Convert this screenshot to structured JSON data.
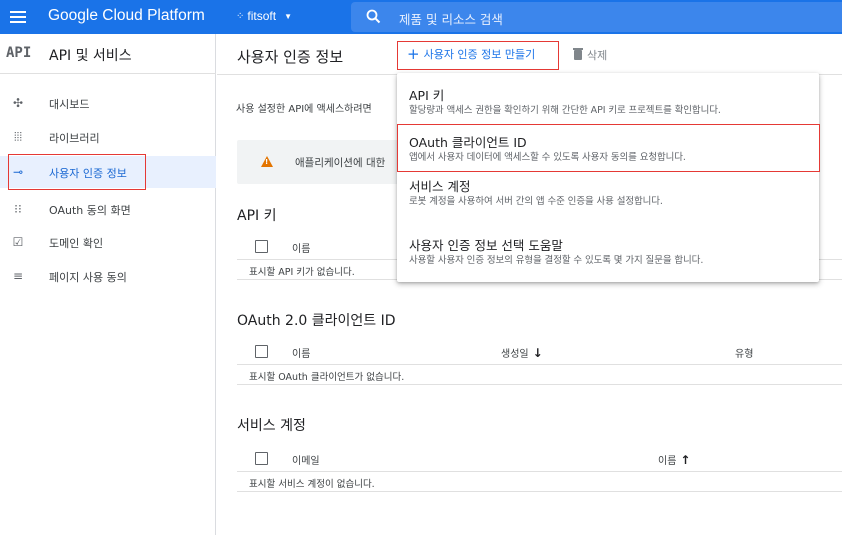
{
  "topbar": {
    "brand": "Google Cloud Platform",
    "project": "fitsoft",
    "search_placeholder": "제품 및 리소스 검색",
    "bg_color": "#1a73e8"
  },
  "sidebar": {
    "logo": "API",
    "title": "API 및 서비스",
    "items": [
      {
        "label": "대시보드",
        "icon": "dashboard-icon"
      },
      {
        "label": "라이브러리",
        "icon": "library-icon"
      },
      {
        "label": "사용자 인증 정보",
        "icon": "key-icon",
        "active": true
      },
      {
        "label": "OAuth 동의 화면",
        "icon": "consent-icon"
      },
      {
        "label": "도메인 확인",
        "icon": "domain-check-icon"
      },
      {
        "label": "페이지 사용 동의",
        "icon": "page-settings-icon"
      }
    ]
  },
  "main": {
    "title": "사용자 인증 정보",
    "create_label": "사용자 인증 정보 만들기",
    "delete_label": "삭제",
    "description": "사용 설정한 API에 액세스하려면",
    "warning": "애플리케이션에 대한",
    "sections": {
      "api_keys": {
        "title": "API 키",
        "col_name": "이름",
        "empty": "표시할 API 키가 없습니다."
      },
      "oauth": {
        "title": "OAuth 2.0 클라이언트 ID",
        "col_name": "이름",
        "col_created": "생성일",
        "col_type": "유형",
        "empty": "표시할 OAuth 클라이언트가 없습니다."
      },
      "service": {
        "title": "서비스 계정",
        "col_email": "이메일",
        "col_name": "이름",
        "empty": "표시할 서비스 계정이 없습니다."
      }
    }
  },
  "dropdown": {
    "items": [
      {
        "title": "API 키",
        "desc": "할당량과 액세스 권한을 확인하기 위해 간단한 API 키로 프로젝트를 확인합니다."
      },
      {
        "title": "OAuth 클라이언트 ID",
        "desc": "앱에서 사용자 데이터에 액세스할 수 있도록 사용자 동의를 요청합니다."
      },
      {
        "title": "서비스 계정",
        "desc": "로봇 계정을 사용하여 서버 간의 앱 수준 인증을 사용 설정합니다."
      },
      {
        "title": "사용자 인증 정보 선택 도움말",
        "desc": "사용할 사용자 인증 정보의 유형을 결정할 수 있도록 몇 가지 질문을 합니다."
      }
    ]
  },
  "highlight_color": "#e53935"
}
